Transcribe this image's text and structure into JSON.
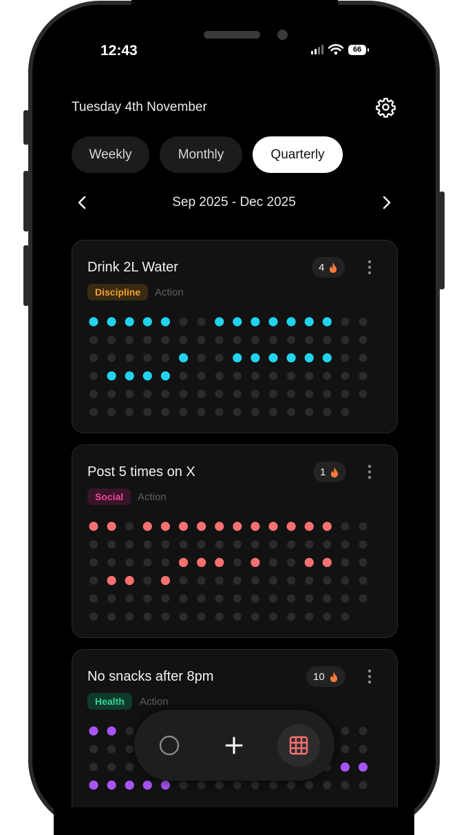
{
  "status_bar": {
    "time": "12:43",
    "battery": "66"
  },
  "header": {
    "date": "Tuesday 4th November"
  },
  "tabs": [
    {
      "label": "Weekly",
      "active": false
    },
    {
      "label": "Monthly",
      "active": false
    },
    {
      "label": "Quarterly",
      "active": true
    }
  ],
  "period": {
    "label": "Sep 2025 - Dec 2025"
  },
  "habits": [
    {
      "title": "Drink 2L Water",
      "streak": "4",
      "tag": "Discipline",
      "tag_color": "#f0a030",
      "tag_bg": "#3a2a12",
      "type": "Action",
      "dot_color": "#22d3ee",
      "grid": [
        "11111001111111..",
        "................",
        ".....1..111111..",
        ".1111...........",
        "................",
        "...............|"
      ]
    },
    {
      "title": "Post 5 times on X",
      "streak": "1",
      "tag": "Social",
      "tag_color": "#ec4899",
      "tag_bg": "#3a1428",
      "type": "Action",
      "dot_color": "#f87171",
      "grid": [
        "11.11111111111..",
        "................",
        ".....111.1..11..",
        ".11.1...........",
        "................",
        "...............|"
      ]
    },
    {
      "title": "No snacks after 8pm",
      "streak": "10",
      "tag": "Health",
      "tag_color": "#34d399",
      "tag_bg": "#0f3a2a",
      "type": "Action",
      "dot_color": "#a855f7",
      "grid": [
        "11..............",
        "................",
        "..............111",
        "11111..........."
      ]
    }
  ],
  "bottom_bar": {
    "items": [
      {
        "icon": "circle-icon",
        "active": false
      },
      {
        "icon": "plus-icon",
        "active": false
      },
      {
        "icon": "grid-icon",
        "active": true
      }
    ],
    "grid_accent": "#f87171"
  }
}
